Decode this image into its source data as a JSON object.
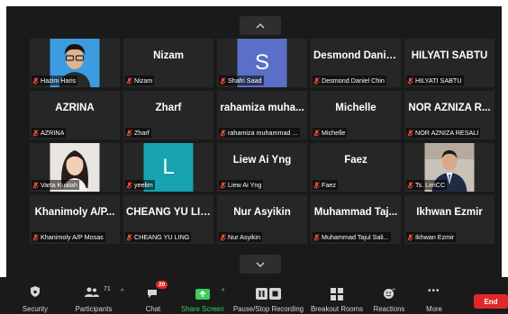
{
  "grid": {
    "tiles": [
      {
        "display": "",
        "label": "Hazim Haris",
        "avatar": "photo-boy"
      },
      {
        "display": "Nizam",
        "label": "Nizam"
      },
      {
        "display": "S",
        "label": "Shafri Saad",
        "avatar": "letter",
        "color": "#5b6fc7"
      },
      {
        "display": "Desmond Danie...",
        "label": "Desmond Daniel Chin"
      },
      {
        "display": "HILYATI SABTU",
        "label": "HILYATI SABTU"
      },
      {
        "display": "AZRINA",
        "label": "AZRINA"
      },
      {
        "display": "Zharf",
        "label": "Zharf"
      },
      {
        "display": "rahamiza muha...",
        "label": "rahamiza muhammad ..."
      },
      {
        "display": "Michelle",
        "label": "Michelle"
      },
      {
        "display": "NOR AZNIZA R...",
        "label": "NOR AZNIZA RESALI"
      },
      {
        "display": "",
        "label": "Varta Kualah",
        "avatar": "photo-girl"
      },
      {
        "display": "L",
        "label": "yeelim",
        "avatar": "letter",
        "color": "#17a3b0"
      },
      {
        "display": "Liew Ai Yng",
        "label": "Liew Ai Yng"
      },
      {
        "display": "Faez",
        "label": "Faez"
      },
      {
        "display": "",
        "label": "Ts. LimCC",
        "avatar": "photo-man"
      },
      {
        "display": "Khanimoly A/P...",
        "label": "Khanimoly A/P Mosas"
      },
      {
        "display": "CHEANG YU LING",
        "label": "CHEANG YU LING"
      },
      {
        "display": "Nur Asyikin",
        "label": "Nur Asyikin"
      },
      {
        "display": "Muhammad Taj...",
        "label": "Muhammad Tajul Sali..."
      },
      {
        "display": "Ikhwan Ezmir",
        "label": "Ikhwan Ezmir"
      }
    ]
  },
  "toolbar": {
    "security": "Security",
    "participants": "Participants",
    "participants_count": "71",
    "chat": "Chat",
    "chat_badge": "20",
    "share_screen": "Share Screen",
    "recording": "Pause/Stop Recording",
    "breakout": "Breakout Rooms",
    "reactions": "Reactions",
    "more": "More",
    "end": "End"
  },
  "colors": {
    "background": "#1a1a1a",
    "tile": "#262626",
    "share_green": "#3ccc5f",
    "end_red": "#e02828"
  }
}
